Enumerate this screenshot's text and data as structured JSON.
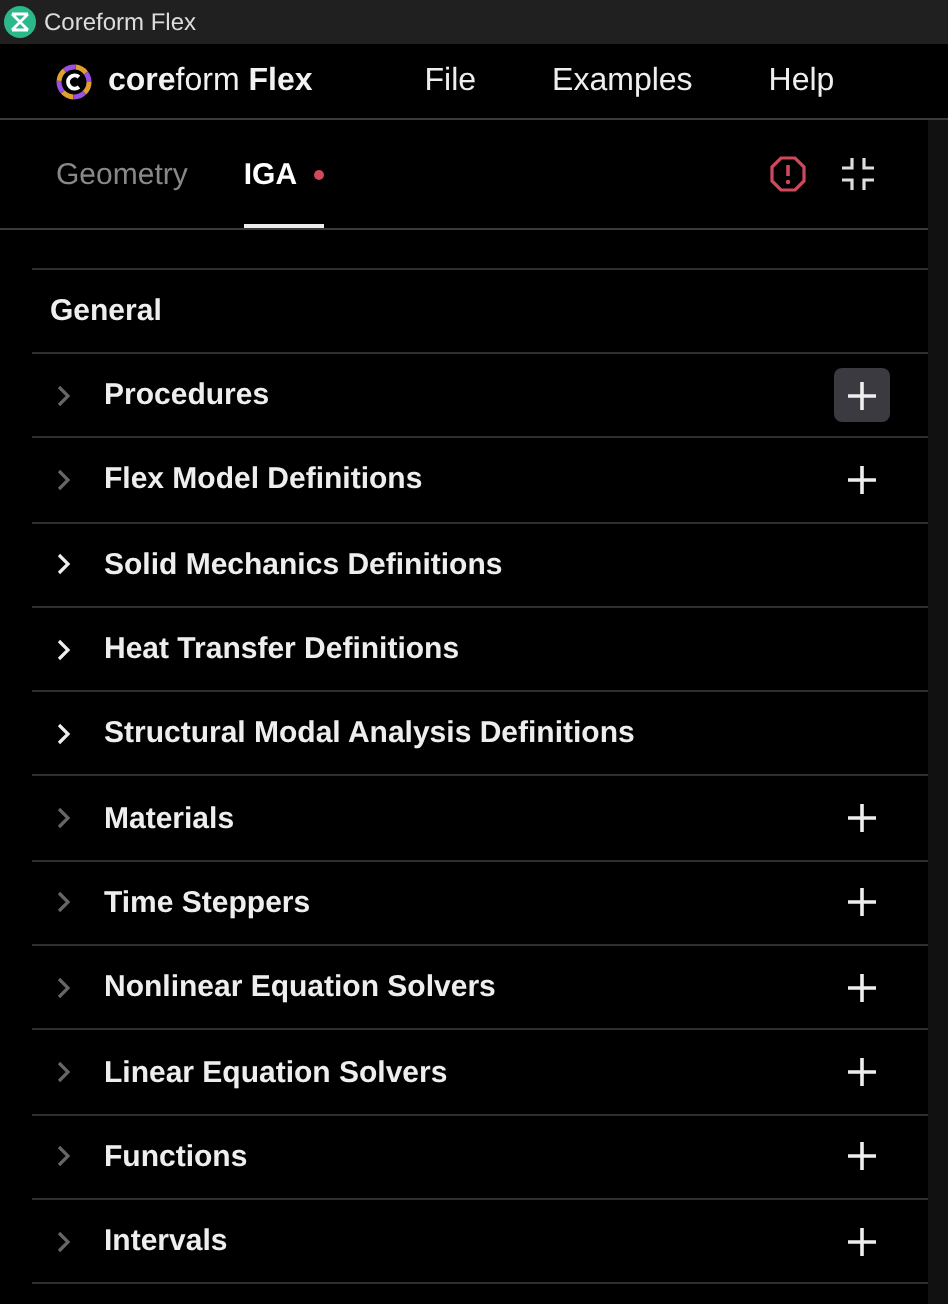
{
  "window": {
    "title": "Coreform Flex"
  },
  "brand": "**core**form **Flex**",
  "menu": [
    "File",
    "Examples",
    "Help"
  ],
  "tabs": [
    {
      "label": "Geometry",
      "selected": false,
      "error_dot": false
    },
    {
      "label": "IGA",
      "selected": true,
      "error_dot": true
    }
  ],
  "section": "General",
  "items": [
    {
      "label": "Procedures",
      "has_children": false,
      "add_button": true,
      "hovered": true
    },
    {
      "label": "Flex Model Definitions",
      "has_children": false,
      "add_button": true
    },
    {
      "label": "Solid Mechanics Definitions",
      "has_children": true,
      "add_button": false
    },
    {
      "label": "Heat Transfer Definitions",
      "has_children": true,
      "add_button": false
    },
    {
      "label": "Structural Modal Analysis Definitions",
      "has_children": true,
      "add_button": false
    },
    {
      "label": "Materials",
      "has_children": false,
      "add_button": true
    },
    {
      "label": "Time Steppers",
      "has_children": false,
      "add_button": true
    },
    {
      "label": "Nonlinear Equation Solvers",
      "has_children": false,
      "add_button": true
    },
    {
      "label": "Linear Equation Solvers",
      "has_children": false,
      "add_button": true
    },
    {
      "label": "Functions",
      "has_children": false,
      "add_button": true
    },
    {
      "label": "Intervals",
      "has_children": false,
      "add_button": true
    }
  ]
}
